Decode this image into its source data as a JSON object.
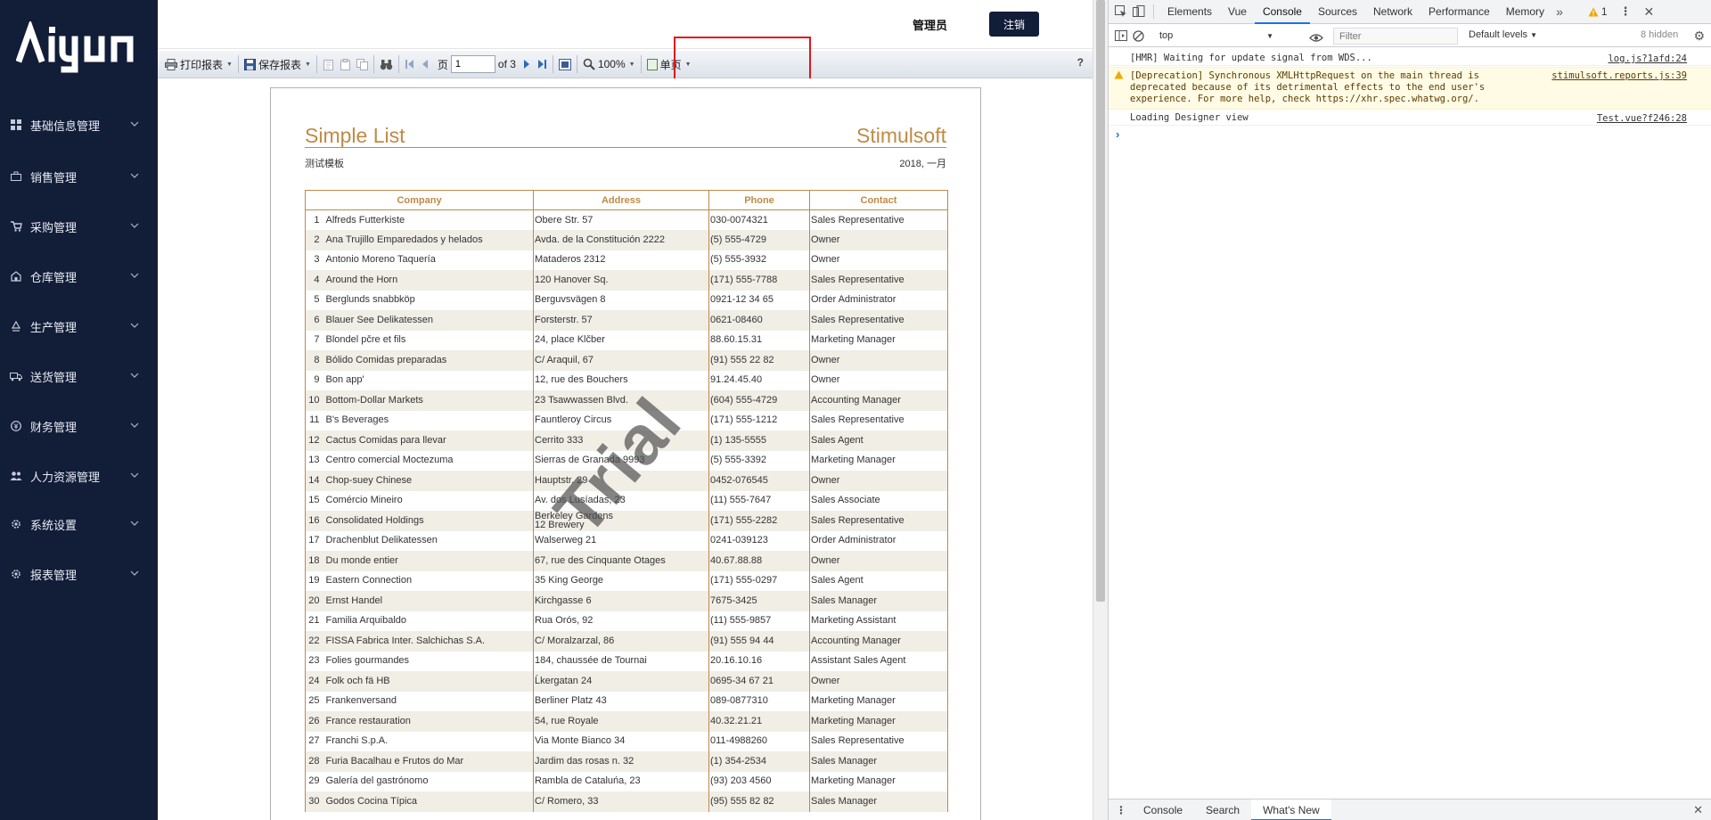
{
  "sidebar": {
    "logo_text": "aiyun",
    "items": [
      {
        "label": "基础信息管理",
        "icon": "grid-icon"
      },
      {
        "label": "销售管理",
        "icon": "briefcase-icon"
      },
      {
        "label": "采购管理",
        "icon": "cart-icon"
      },
      {
        "label": "仓库管理",
        "icon": "warehouse-icon"
      },
      {
        "label": "生产管理",
        "icon": "recycle-icon"
      },
      {
        "label": "送货管理",
        "icon": "truck-icon"
      },
      {
        "label": "财务管理",
        "icon": "money-icon"
      },
      {
        "label": "人力资源管理",
        "icon": "people-icon"
      },
      {
        "label": "系统设置",
        "icon": "gear-icon"
      },
      {
        "label": "报表管理",
        "icon": "gear-icon"
      }
    ]
  },
  "header": {
    "user": "管理员",
    "logout": "注销"
  },
  "toolbar": {
    "print": "打印报表",
    "save": "保存报表",
    "page_label": "页",
    "page_value": "1",
    "page_total": "of 3",
    "zoom": "100%",
    "view_mode": "单页",
    "help": "?"
  },
  "report": {
    "title": "Simple List",
    "brand": "Stimulsoft",
    "subtitle": "测试模板",
    "date": "2018, 一月",
    "watermark": "Trial",
    "columns": [
      "Company",
      "Address",
      "Phone",
      "Contact"
    ],
    "rows": [
      [
        "1",
        "Alfreds Futterkiste",
        "Obere Str. 57",
        "030-0074321",
        "Sales Representative"
      ],
      [
        "2",
        "Ana Trujillo Emparedados y helados",
        "Avda. de la Constitución 2222",
        "(5) 555-4729",
        "Owner"
      ],
      [
        "3",
        "Antonio Moreno Taquería",
        "Mataderos 2312",
        "(5) 555-3932",
        "Owner"
      ],
      [
        "4",
        "Around the Horn",
        "120 Hanover Sq.",
        "(171) 555-7788",
        "Sales Representative"
      ],
      [
        "5",
        "Berglunds snabbköp",
        "Berguvsvägen 8",
        "0921-12 34 65",
        "Order Administrator"
      ],
      [
        "6",
        "Blauer See Delikatessen",
        "Forsterstr. 57",
        "0621-08460",
        "Sales Representative"
      ],
      [
        "7",
        "Blondel pčre et fils",
        "24, place Klčber",
        "88.60.15.31",
        "Marketing Manager"
      ],
      [
        "8",
        "Bólido Comidas preparadas",
        "C/ Araquil, 67",
        "(91) 555 22 82",
        "Owner"
      ],
      [
        "9",
        "Bon app'",
        "12, rue des Bouchers",
        "91.24.45.40",
        "Owner"
      ],
      [
        "10",
        "Bottom-Dollar Markets",
        "23 Tsawwassen Blvd.",
        "(604) 555-4729",
        "Accounting Manager"
      ],
      [
        "11",
        "B's Beverages",
        "Fauntleroy Circus",
        "(171) 555-1212",
        "Sales Representative"
      ],
      [
        "12",
        "Cactus Comidas para llevar",
        "Cerrito 333",
        "(1) 135-5555",
        "Sales Agent"
      ],
      [
        "13",
        "Centro comercial Moctezuma",
        "Sierras de Granada 9993",
        "(5) 555-3392",
        "Marketing Manager"
      ],
      [
        "14",
        "Chop-suey Chinese",
        "Hauptstr. 29",
        "0452-076545",
        "Owner"
      ],
      [
        "15",
        "Comércio Mineiro",
        "Av. dos Lusíadas, 23",
        "(11) 555-7647",
        "Sales Associate"
      ],
      [
        "16",
        "Consolidated Holdings",
        "Berkeley Gardens\n12 Brewery",
        "(171) 555-2282",
        "Sales Representative"
      ],
      [
        "17",
        "Drachenblut Delikatessen",
        "Walserweg 21",
        "0241-039123",
        "Order Administrator"
      ],
      [
        "18",
        "Du monde entier",
        "67, rue des Cinquante Otages",
        "40.67.88.88",
        "Owner"
      ],
      [
        "19",
        "Eastern Connection",
        "35 King George",
        "(171) 555-0297",
        "Sales Agent"
      ],
      [
        "20",
        "Ernst Handel",
        "Kirchgasse 6",
        "7675-3425",
        "Sales Manager"
      ],
      [
        "21",
        "Familia Arquibaldo",
        "Rua Orós, 92",
        "(11) 555-9857",
        "Marketing Assistant"
      ],
      [
        "22",
        "FISSA Fabrica Inter. Salchichas S.A.",
        "C/ Moralzarzal, 86",
        "(91) 555 94 44",
        "Accounting Manager"
      ],
      [
        "23",
        "Folies gourmandes",
        "184, chaussée de Tournai",
        "20.16.10.16",
        "Assistant Sales Agent"
      ],
      [
        "24",
        "Folk och fä HB",
        "Ĺkergatan 24",
        "0695-34 67 21",
        "Owner"
      ],
      [
        "25",
        "Frankenversand",
        "Berliner Platz 43",
        "089-0877310",
        "Marketing Manager"
      ],
      [
        "26",
        "France restauration",
        "54, rue Royale",
        "40.32.21.21",
        "Marketing Manager"
      ],
      [
        "27",
        "Franchi S.p.A.",
        "Via Monte Bianco 34",
        "011-4988260",
        "Sales Representative"
      ],
      [
        "28",
        "Furia Bacalhau e Frutos do Mar",
        "Jardim das rosas n. 32",
        "(1) 354-2534",
        "Sales Manager"
      ],
      [
        "29",
        "Galería del gastrónomo",
        "Rambla de Cataluńa, 23",
        "(93) 203 4560",
        "Marketing Manager"
      ],
      [
        "30",
        "Godos Cocina Típica",
        "C/ Romero, 33",
        "(95) 555 82 82",
        "Sales Manager"
      ]
    ]
  },
  "devtools": {
    "tabs": [
      "Elements",
      "Vue",
      "Console",
      "Sources",
      "Network",
      "Performance",
      "Memory"
    ],
    "active_tab": "Console",
    "warning_count": "1",
    "context": "top",
    "filter_placeholder": "Filter",
    "levels": "Default levels",
    "hidden": "8 hidden",
    "messages": [
      {
        "text": "[HMR] Waiting for update signal from WDS...",
        "source": "log.js?1afd:24"
      },
      {
        "text": "[Deprecation] Synchronous XMLHttpRequest on the main thread is deprecated because of its detrimental effects to the end user's experience. For more help, check https://xhr.spec.whatwg.org/.",
        "source": "stimulsoft.reports.js:39"
      },
      {
        "text": "Loading Designer view",
        "source": "Test.vue?f246:28"
      }
    ],
    "bottom_tabs": [
      "Console",
      "Search",
      "What's New"
    ]
  }
}
